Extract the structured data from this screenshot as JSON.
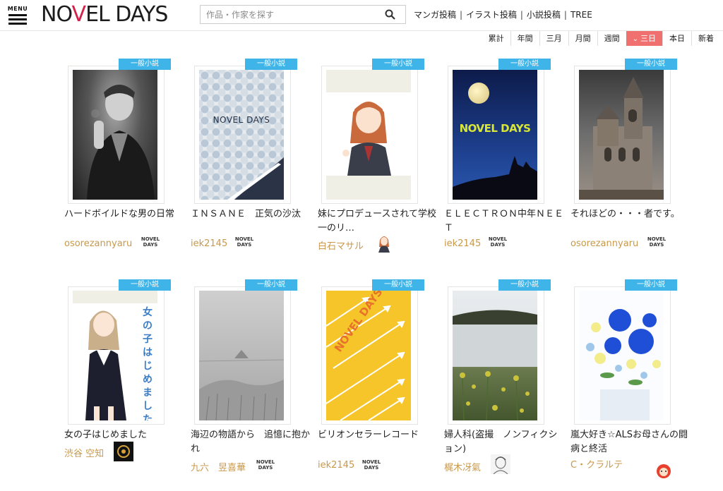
{
  "header": {
    "menu_label": "MENU",
    "logo_text": [
      "NO",
      "V",
      "EL DAYS"
    ],
    "search_placeholder": "作品・作家を探す",
    "links": [
      "マンガ投稿",
      "イラスト投稿",
      "小説投稿",
      "TREE"
    ]
  },
  "periods": [
    {
      "label": "累計",
      "active": false
    },
    {
      "label": "年間",
      "active": false
    },
    {
      "label": "三月",
      "active": false
    },
    {
      "label": "月間",
      "active": false
    },
    {
      "label": "週間",
      "active": false
    },
    {
      "label": "三日",
      "active": true
    },
    {
      "label": "本日",
      "active": false
    },
    {
      "label": "新着",
      "active": false
    }
  ],
  "colors": {
    "accent": "#f07070",
    "badge": "#3eb4e8",
    "author": "#c9984a"
  },
  "cards": [
    {
      "badge": "一般小説",
      "title": "ハードボイルドな男の日常",
      "author": "osorezannyaru",
      "author_icon": "novel-days-logo-icon",
      "cover": "bw-portrait-smoking-man"
    },
    {
      "badge": "一般小説",
      "title": "ＩＮＳＡＮＥ　正気の沙汰",
      "author": "iek2145",
      "author_icon": "novel-days-logo-icon",
      "cover": "novel-days-pattern"
    },
    {
      "badge": "一般小説",
      "title": "妹にプロデュースされて学校一のリ…",
      "author": "白石マサル",
      "author_icon": "anime-avatar-icon",
      "cover": "anime-schoolgirl"
    },
    {
      "badge": "一般小説",
      "title": "ＥＬＥＣＴＲＯＮ中年ＮＥＥＴ",
      "author": "iek2145",
      "author_icon": "novel-days-logo-icon",
      "cover": "novel-days-moon"
    },
    {
      "badge": "一般小説",
      "title": "それほどの・・・者です。",
      "author": "osorezannyaru",
      "author_icon": "novel-days-logo-icon",
      "cover": "church-photo"
    },
    {
      "badge": "一般小説",
      "title": "女の子はじめました",
      "author": "渋谷 空知",
      "author_icon": "dark-emblem-avatar-icon",
      "cover": "anime-girl-sailor"
    },
    {
      "badge": "一般小説",
      "title": "海辺の物語から　追憶に抱かれ",
      "author": "九六　昱喜華",
      "author_icon": "novel-days-logo-icon",
      "cover": "gray-sea-sketch"
    },
    {
      "badge": "一般小説",
      "title": "ビリオンセラーレコード",
      "author": "iek2145",
      "author_icon": "novel-days-logo-icon",
      "cover": "novel-days-yellow"
    },
    {
      "badge": "一般小説",
      "title": "婦人科(盗撮　ノンフィクション)",
      "author": "梶木冴氣",
      "author_icon": "sketch-avatar-icon",
      "cover": "lake-flowers-photo"
    },
    {
      "badge": "一般小説",
      "title": "嵐大好き☆ALSお母さんの闘病と終活",
      "author": "C・クラルテ",
      "author_icon": "character-avatar-icon",
      "cover": "blue-roses-photo"
    }
  ],
  "cover_text": {
    "nd_pattern": "NOVEL DAYS",
    "nd_moon": "NOVEL DAYS",
    "nd_yellow": "NOVEL DAYS",
    "girl_title": "女の子はじめました",
    "nd_icon": [
      "NOVEL",
      "DAYS"
    ]
  }
}
